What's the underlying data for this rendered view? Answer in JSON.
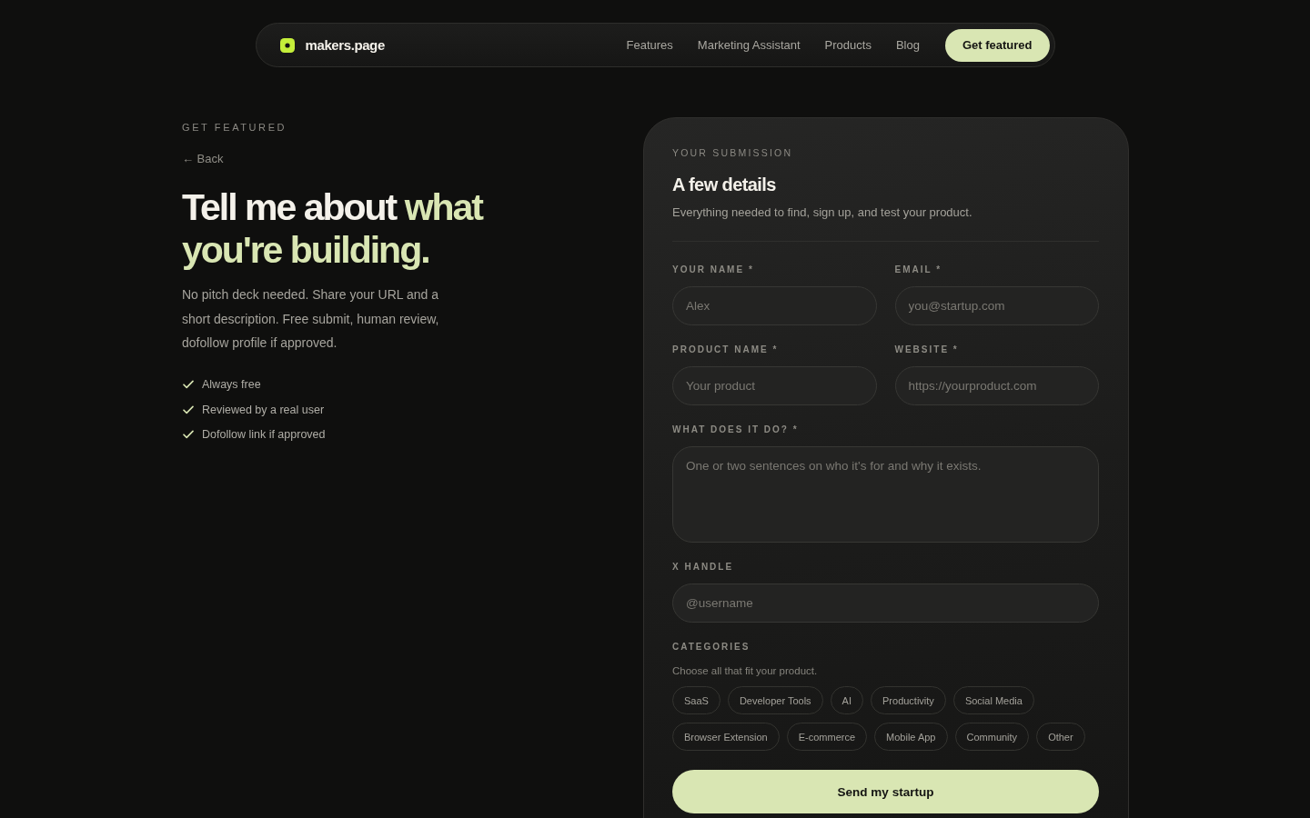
{
  "nav": {
    "brand": "makers.page",
    "links": [
      "Features",
      "Marketing Assistant",
      "Products",
      "Blog"
    ],
    "cta": "Get featured"
  },
  "intro": {
    "eyebrow": "GET FEATURED",
    "back_link": "← Back",
    "heading": {
      "lead": "Tell me about",
      "accent": "what you're building."
    },
    "description": "No pitch deck needed. Share your URL and a short description. Free submit, human review, dofollow profile if approved.",
    "perks": [
      "Always free",
      "Reviewed by a real user",
      "Dofollow link if approved"
    ]
  },
  "form": {
    "eyebrow": "YOUR SUBMISSION",
    "title": "A few details",
    "subtitle": "Everything needed to find, sign up, and test your product.",
    "field_rows": [
      [
        {
          "kind": "input",
          "label": "YOUR NAME *",
          "placeholder": "Alex"
        },
        {
          "kind": "input",
          "label": "EMAIL *",
          "placeholder": "you@startup.com"
        }
      ],
      [
        {
          "kind": "input",
          "label": "PRODUCT NAME *",
          "placeholder": "Your product"
        },
        {
          "kind": "input",
          "label": "WEBSITE *",
          "placeholder": "https://yourproduct.com"
        }
      ],
      [
        {
          "kind": "textarea",
          "label": "WHAT DOES IT DO? *",
          "placeholder": "One or two sentences on who it's for and why it exists."
        }
      ],
      [
        {
          "kind": "input",
          "label": "X HANDLE",
          "placeholder": "@username"
        }
      ]
    ],
    "categories": {
      "label": "CATEGORIES",
      "hint": "Choose all that fit your product.",
      "options": [
        {
          "label": "SaaS",
          "selected": false
        },
        {
          "label": "Developer Tools",
          "selected": false
        },
        {
          "label": "AI",
          "selected": false
        },
        {
          "label": "Productivity",
          "selected": false
        },
        {
          "label": "Social Media",
          "selected": false
        },
        {
          "label": "Browser Extension",
          "selected": false
        },
        {
          "label": "E-commerce",
          "selected": false
        },
        {
          "label": "Mobile App",
          "selected": false
        },
        {
          "label": "Community",
          "selected": false
        },
        {
          "label": "Other",
          "selected": false
        }
      ]
    },
    "submit": "Send my startup"
  }
}
